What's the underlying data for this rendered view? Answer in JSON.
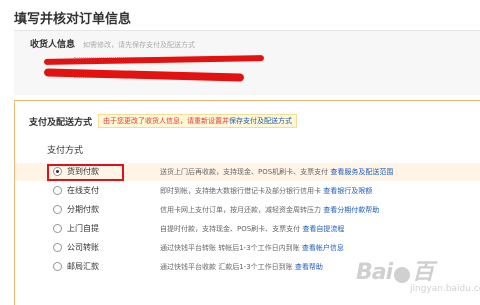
{
  "page": {
    "title": "填写并核对订单信息"
  },
  "consignee": {
    "title": "收货人信息",
    "note": "如需修改，请先保存支付及配送方式"
  },
  "payment": {
    "title": "支付及配送方式",
    "notice_text": "由于您更改了收货人信息，请重新设置并",
    "notice_link": "保存支付及配送方式",
    "method_label": "支付方式",
    "options": [
      {
        "name": "货到付款",
        "desc": "送货上门后再收款，支持现金、POS机刷卡、支票支付",
        "link": "查看服务及配送范围",
        "selected": true
      },
      {
        "name": "在线支付",
        "desc": "即时到帐，支持绝大数银行借记卡及部分银行信用卡",
        "link": "查看银行及限额",
        "selected": false
      },
      {
        "name": "分期付款",
        "desc": "信用卡网上支付订单，按月还款，减轻资金周转压力",
        "link": "查看分期付款帮助",
        "selected": false
      },
      {
        "name": "上门自提",
        "desc": "自提时付款，支持现金、POS刷卡、支票支付",
        "link": "查看自提流程",
        "selected": false
      },
      {
        "name": "公司转账",
        "desc": "通过快钱平台转账 转帐后1-3个工作日内到账",
        "link": "查看帐户信息",
        "selected": false
      },
      {
        "name": "邮局汇款",
        "desc": "通过快钱平台收款 汇款后1-3个工作日到账",
        "link": "查看帮助",
        "selected": false
      }
    ]
  },
  "watermark": {
    "logo": "Bai",
    "logo_tail": "百",
    "sub": "jingyan.baidu.com"
  }
}
